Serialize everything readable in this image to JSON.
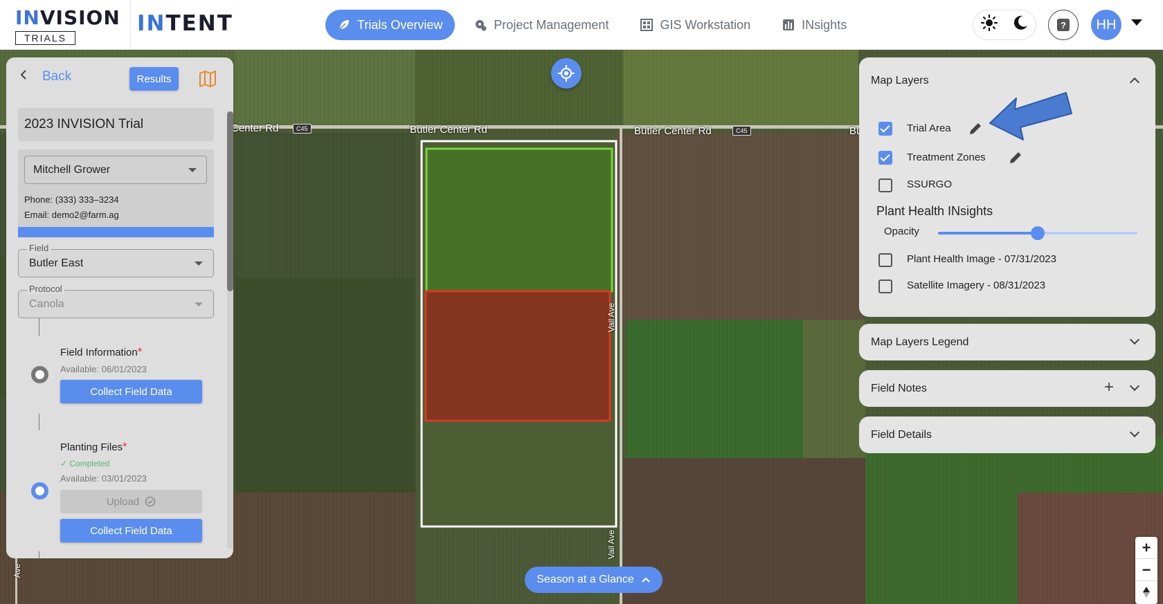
{
  "brand": {
    "logo_word_accent": "IN",
    "logo_word_rest": "VISION",
    "logo_sub": "TRIALS",
    "product_accent": "IN",
    "product_rest": "TENT"
  },
  "nav": {
    "items": [
      {
        "label": "Trials Overview",
        "icon": "leaf-icon",
        "active": true
      },
      {
        "label": "Project Management",
        "icon": "gear-icon",
        "active": false
      },
      {
        "label": "GIS Workstation",
        "icon": "grid-icon",
        "active": false
      },
      {
        "label": "INsights",
        "icon": "bars-icon",
        "active": false
      }
    ]
  },
  "user": {
    "initials": "HH"
  },
  "left_panel": {
    "back_label": "Back",
    "results_label": "Results",
    "trial_title": "2023 INVISION Trial",
    "grower": "Mitchell Grower",
    "phone": "Phone: (333) 333–3234",
    "email": "Email: demo2@farm.ag",
    "field_label": "Field",
    "field_value": "Butler East",
    "protocol_label": "Protocol",
    "protocol_value": "Canola",
    "steps": [
      {
        "title": "Field Information",
        "required_mark": "*",
        "available": "Available: 06/01/2023",
        "button": "Collect Field Data"
      },
      {
        "title": "Planting Files",
        "required_mark": "*",
        "status": "Completed",
        "available": "Available: 03/01/2023",
        "upload_label": "Upload",
        "button": "Collect Field Data"
      }
    ]
  },
  "map": {
    "roads": {
      "road_left": "Center Rd",
      "road_center": "Butler Center Rd",
      "road_right": "Butler Center Rd",
      "road_right_cut": "Bu",
      "shield_1": "C45",
      "shield_2": "C45",
      "vertical_1": "Vail Ave",
      "vertical_2": "Vail Ave",
      "vertical_left": "Ave"
    },
    "season_button": "Season at a Glance"
  },
  "map_layers": {
    "title": "Map Layers",
    "layers": [
      {
        "label": "Trial Area",
        "checked": true
      },
      {
        "label": "Treatment Zones",
        "checked": true
      },
      {
        "label": "SSURGO",
        "checked": false
      }
    ],
    "plant_health_title": "Plant Health INsights",
    "opacity_label": "Opacity",
    "opacity_value": 0.5,
    "imagery": [
      {
        "label": "Plant Health Image - 07/31/2023",
        "checked": false
      },
      {
        "label": "Satellite Imagery - 08/31/2023",
        "checked": false
      }
    ]
  },
  "panels": {
    "legend_title": "Map Layers Legend",
    "notes_title": "Field Notes",
    "details_title": "Field Details"
  },
  "colors": {
    "accent": "#5b8def",
    "trial_green": "#7bd43a",
    "zone_red": "#d83a20",
    "boundary": "#ffffff"
  }
}
